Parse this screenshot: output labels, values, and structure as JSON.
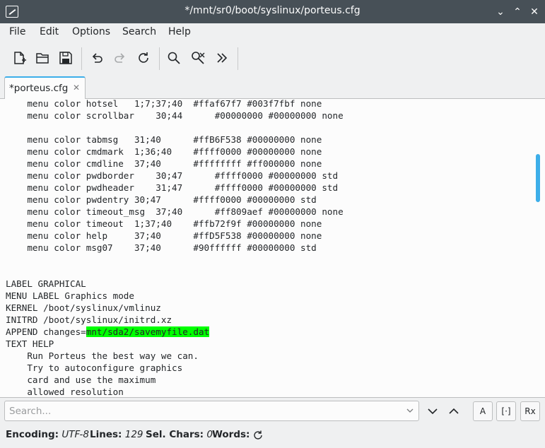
{
  "window": {
    "title": "*/mnt/sr0/boot/syslinux/porteus.cfg",
    "minimize_glyph": "⌄",
    "maximize_glyph": "⌃",
    "close_glyph": "✕"
  },
  "menu": [
    "File",
    "Edit",
    "Options",
    "Search",
    "Help"
  ],
  "toolbar": {
    "icons": [
      "new-document-icon",
      "open-folder-icon",
      "save-icon",
      "undo-icon",
      "redo-icon",
      "reload-icon",
      "find-icon",
      "find-replace-icon",
      "more-icon"
    ]
  },
  "tab": {
    "label": "*porteus.cfg",
    "close_glyph": "✕"
  },
  "editor": {
    "lines": [
      "    menu color hotsel   1;7;37;40  #ffaf67f7 #003f7fbf none",
      "    menu color scrollbar    30;44      #00000000 #00000000 none",
      "",
      "    menu color tabmsg   31;40      #ffB6F538 #00000000 none",
      "    menu color cmdmark  1;36;40    #ffff0000 #00000000 none",
      "    menu color cmdline  37;40      #ffffffff #ff000000 none",
      "    menu color pwdborder    30;47      #ffff0000 #00000000 std",
      "    menu color pwdheader    31;47      #ffff0000 #00000000 std",
      "    menu color pwdentry 30;47      #ffff0000 #00000000 std",
      "    menu color timeout_msg  37;40      #ff809aef #00000000 none",
      "    menu color timeout  1;37;40    #ffb72f9f #00000000 none",
      "    menu color help     37;40      #ffD5F538 #00000000 none",
      "    menu color msg07    37;40      #90ffffff #00000000 std",
      "",
      "",
      "LABEL GRAPHICAL",
      "MENU LABEL Graphics mode",
      "KERNEL /boot/syslinux/vmlinuz",
      "INITRD /boot/syslinux/initrd.xz",
      "",
      "TEXT HELP",
      "    Run Porteus the best way we can.",
      "    Try to autoconfigure graphics",
      "    card and use the maximum",
      "    allowed resolution"
    ],
    "append_prefix": "APPEND changes=",
    "append_highlight": "mnt/sda2/savemyfile.dat",
    "highlight_color": "#00ff00"
  },
  "search": {
    "placeholder": "Search...",
    "case_button": "A",
    "whole_word_button": "[·]",
    "regex_button": "Rx"
  },
  "status": {
    "encoding_label": "Encoding:",
    "encoding_value": "UTF-8",
    "lines_label": "Lines:",
    "lines_value": "129",
    "sel_label": "Sel. Chars:",
    "sel_value": "0",
    "words_label": "Words:"
  },
  "colors": {
    "accent": "#3daee9",
    "titlebar": "#475057"
  }
}
